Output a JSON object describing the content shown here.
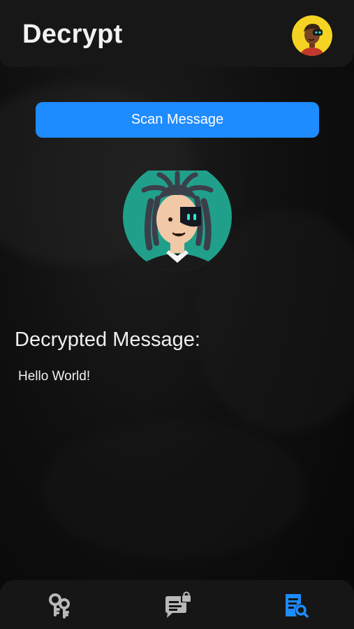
{
  "header": {
    "title": "Decrypt",
    "avatar_icon": "user-avatar-icon"
  },
  "scan": {
    "button_label": "Scan Message"
  },
  "main": {
    "illustration_icon": "hacker-avatar-icon",
    "heading": "Decrypted Message:",
    "message": "Hello World!"
  },
  "bottom_nav": {
    "items": [
      {
        "icon": "keys-icon",
        "active": false
      },
      {
        "icon": "secure-chat-icon",
        "active": false
      },
      {
        "icon": "decrypt-search-icon",
        "active": true
      }
    ]
  },
  "colors": {
    "accent": "#1e8bff",
    "background": "#0a0a0a",
    "header": "#171717",
    "nav_inactive": "#b8b8b8",
    "avatar_ring": "#20a08b",
    "profile_ring": "#f5d322"
  }
}
